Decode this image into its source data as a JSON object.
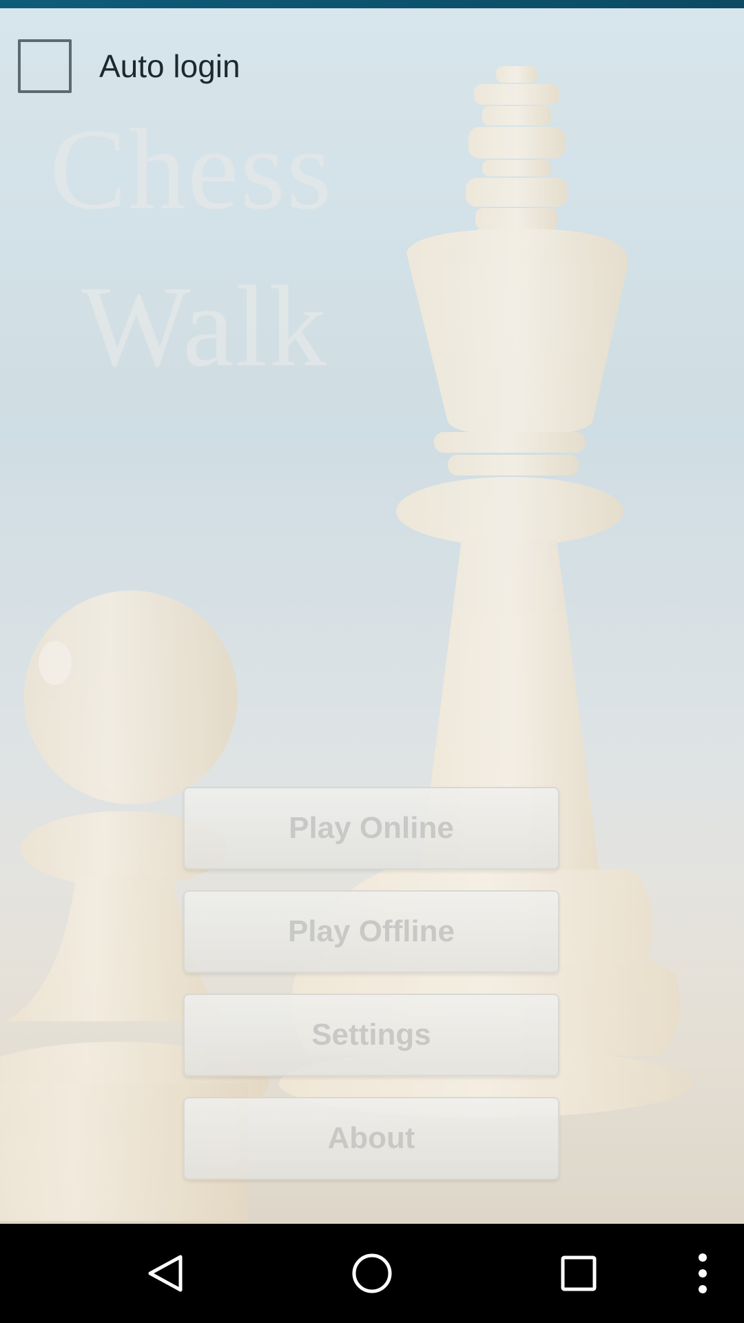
{
  "theme": {
    "status_strip_color": "#0f5c7a",
    "button_text_color": "#c8c8c6",
    "label_color": "#1c2a30",
    "navbar_color": "#000000"
  },
  "auto_login": {
    "label": "Auto login",
    "checked": false
  },
  "title": {
    "line1": "Chess",
    "line2": "Walk"
  },
  "menu": {
    "play_online": "Play Online",
    "play_offline": "Play Offline",
    "settings": "Settings",
    "about": "About"
  },
  "background": {
    "image": "chess-king-and-pawn-photo"
  },
  "navigation_bar": {
    "icons": [
      "back-icon",
      "home-icon",
      "recents-icon",
      "overflow-menu-icon"
    ]
  }
}
